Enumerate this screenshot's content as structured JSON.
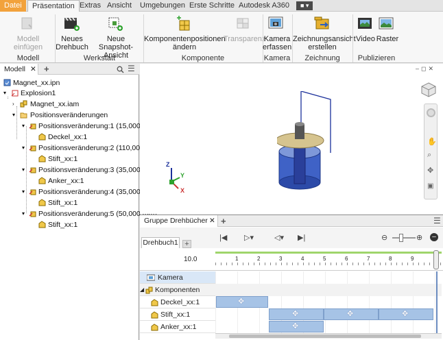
{
  "tabs": [
    "Datei",
    "Präsentation",
    "Extras",
    "Ansicht",
    "Umgebungen",
    "Erste Schritte",
    "Autodesk A360"
  ],
  "ribbon": {
    "modell_einfuegen": "Modell einfügen",
    "neues_drehbuch_1": "Neues",
    "neues_drehbuch_2": "Drehbuch",
    "neue_snapshot_1": "Neue",
    "neue_snapshot_2": "Snapshot-Ansicht",
    "komponentenpos_1": "Komponentenpositionen",
    "komponentenpos_2": "ändern",
    "transparenz": "Transparenz",
    "kamera_1": "Kamera",
    "kamera_2": "erfassen",
    "zeichnung_1": "Zeichnungsansicht",
    "zeichnung_2": "erstellen",
    "video": "Video",
    "raster": "Raster",
    "groups": {
      "modell": "Modell",
      "werkstatt": "Werkstatt",
      "komponente": "Komponente",
      "kamera": "Kamera",
      "zeichnung": "Zeichnung",
      "publizieren": "Publizieren"
    }
  },
  "browser": {
    "tab": "Modell",
    "items": [
      "Magnet_xx.ipn",
      "Explosion1",
      "Magnet_xx.iam",
      "Positionsveränderungen",
      "Positionsveränderung:1 (15,000 mm)",
      "Deckel_xx:1",
      "Positionsveränderung:2 (110,000 mm)",
      "Stift_xx:1",
      "Positionsveränderung:3 (35,000 mm)",
      "Anker_xx:1",
      "Positionsveränderung:4 (35,000 mm)",
      "Stift_xx:1",
      "Positionsveränderung:5 (50,000 mm)",
      "Stift_xx:1"
    ]
  },
  "storyboard": {
    "panel_title": "Gruppe Drehbücher",
    "tab": "Drehbuch1",
    "time": "10.0",
    "ticks": [
      "1",
      "2",
      "3",
      "4",
      "5",
      "6",
      "7",
      "8",
      "9"
    ],
    "tracks": [
      "Kamera",
      "Komponenten",
      "Deckel_xx:1",
      "Stift_xx:1",
      "Anker_xx:1"
    ]
  },
  "axes": {
    "x": "X",
    "y": "Y",
    "z": "Z"
  }
}
